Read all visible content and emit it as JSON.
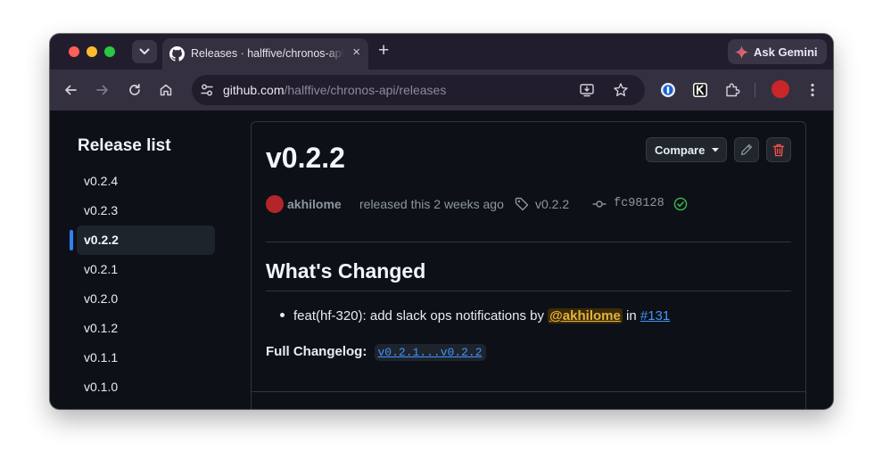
{
  "browser": {
    "tab_title": "Releases · halffive/chronos-api",
    "tab_close": "×",
    "new_tab": "+",
    "ask_gemini": "Ask Gemini",
    "url_host": "github.com",
    "url_path": "/halffive/chronos-api/releases",
    "colors": {
      "tab_strip": "#221d2d",
      "toolbar": "#35303f",
      "profile": "#c8262a"
    }
  },
  "sidebar": {
    "title": "Release list",
    "items": [
      {
        "label": "v0.2.4"
      },
      {
        "label": "v0.2.3"
      },
      {
        "label": "v0.2.2",
        "active": true
      },
      {
        "label": "v0.2.1"
      },
      {
        "label": "v0.2.0"
      },
      {
        "label": "v0.1.2"
      },
      {
        "label": "v0.1.1"
      },
      {
        "label": "v0.1.0"
      }
    ]
  },
  "release": {
    "version": "v0.2.2",
    "compare_label": "Compare",
    "author": "akhilome",
    "released_text": "released this 2 weeks ago",
    "tag": "v0.2.2",
    "commit": "fc98128",
    "section_title": "What's Changed",
    "change_prefix": "feat(hf-320): add slack ops notifications by",
    "change_mention": "@akhilome",
    "change_in": "in",
    "change_pr": "#131",
    "changelog_label": "Full Changelog:",
    "changelog_link": "v0.2.1...v0.2.2"
  },
  "icons": [
    "chevron-down-icon",
    "github-icon",
    "gemini-icon",
    "back-icon",
    "forward-icon",
    "reload-icon",
    "home-icon",
    "tune-icon",
    "install-icon",
    "star-icon",
    "password-manager-icon",
    "extension-k-icon",
    "puzzle-icon",
    "menu-icon",
    "pencil-icon",
    "trash-icon",
    "tag-icon",
    "commit-icon",
    "check-circle-icon"
  ]
}
